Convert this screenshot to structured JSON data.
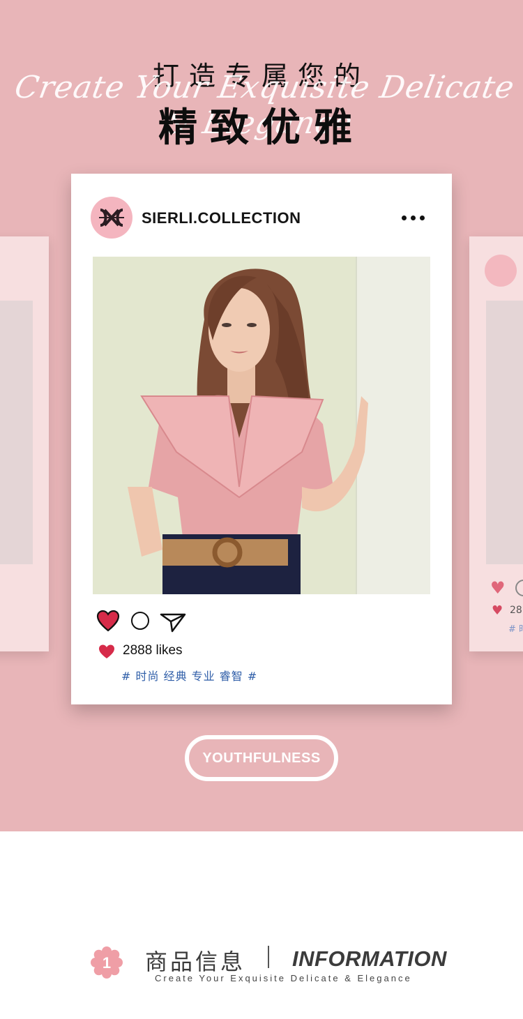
{
  "header": {
    "title_line1": "打造专属您的",
    "title_script": "Create Your Exquisite Delicate & Elegance",
    "title_line2": "精致优雅"
  },
  "post": {
    "username": "SIERLI.COLLECTION",
    "likes": "2888 likes",
    "tags": "# 时尚 经典 专业 睿智 #",
    "more_icon": "more-dots-icon",
    "heart_color": "#d62b49"
  },
  "ghost_right": {
    "likes_partial": "28",
    "tag_partial": "# 时"
  },
  "badge": {
    "label": "YOUTHFULNESS"
  },
  "info": {
    "number": "1",
    "title_cn": "商品信息",
    "title_en": "INFORMATION",
    "subtitle": "Create Your Exquisite Delicate & Elegance"
  },
  "colors": {
    "hero_bg": "#e8b5b8",
    "tag_blue": "#2f5ea8",
    "accent_pink": "#f4b5bf"
  }
}
